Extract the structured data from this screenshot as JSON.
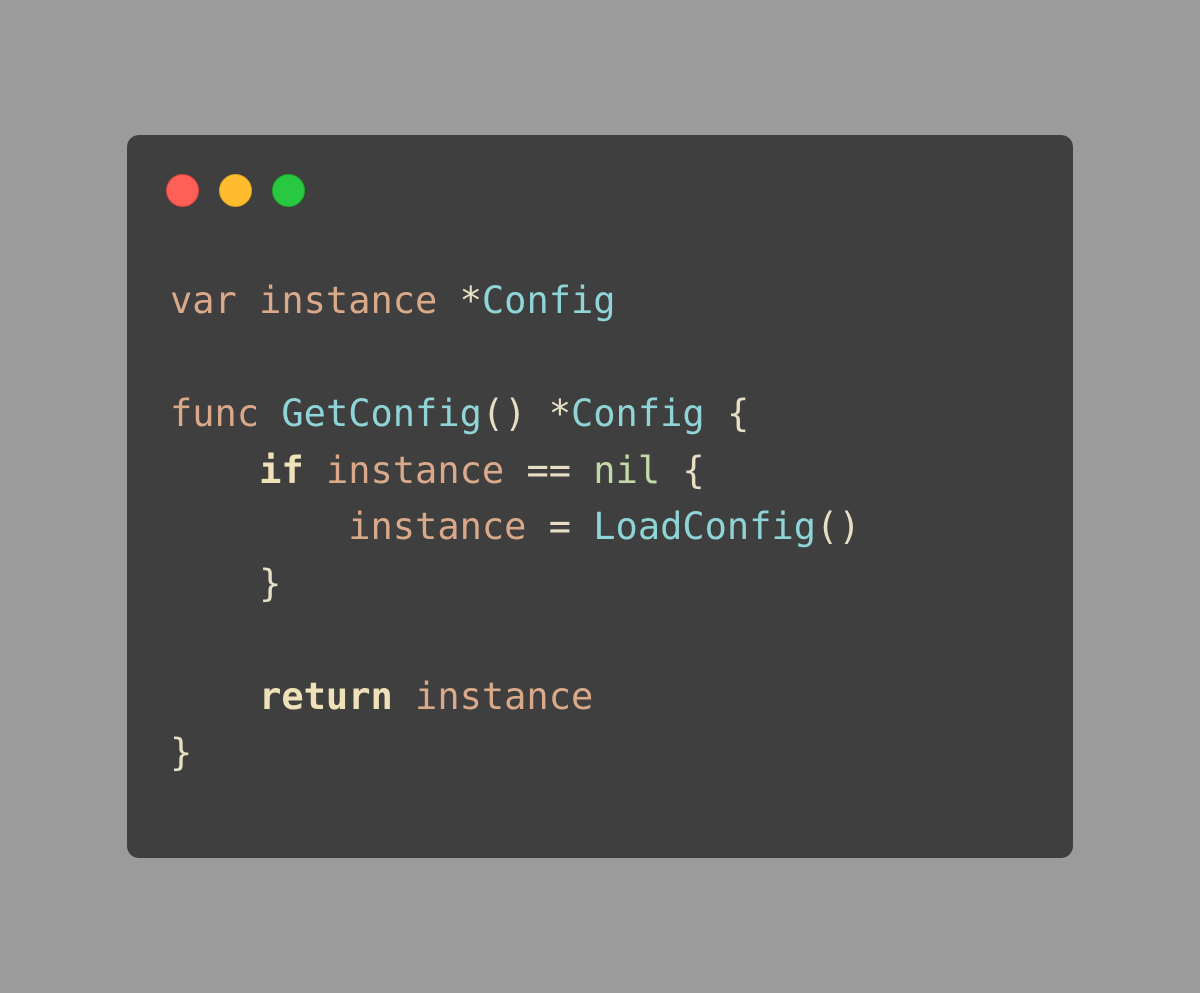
{
  "window": {
    "controls": {
      "close_color": "#fe5f57",
      "minimize_color": "#febc2e",
      "zoom_color": "#28c840"
    }
  },
  "code": {
    "line1": {
      "kw": "var",
      "ident": "instance",
      "star": "*",
      "type": "Config"
    },
    "line3": {
      "kw": "func",
      "fname": "GetConfig",
      "parens": "()",
      "star": "*",
      "type": "Config",
      "brace": "{"
    },
    "line4": {
      "kw": "if",
      "ident": "instance",
      "op": "==",
      "nil": "nil",
      "brace": "{"
    },
    "line5": {
      "ident": "instance",
      "op": "=",
      "fname": "LoadConfig",
      "parens": "()"
    },
    "line6": {
      "brace": "}"
    },
    "line8": {
      "kw": "return",
      "ident": "instance"
    },
    "line9": {
      "brace": "}"
    }
  }
}
